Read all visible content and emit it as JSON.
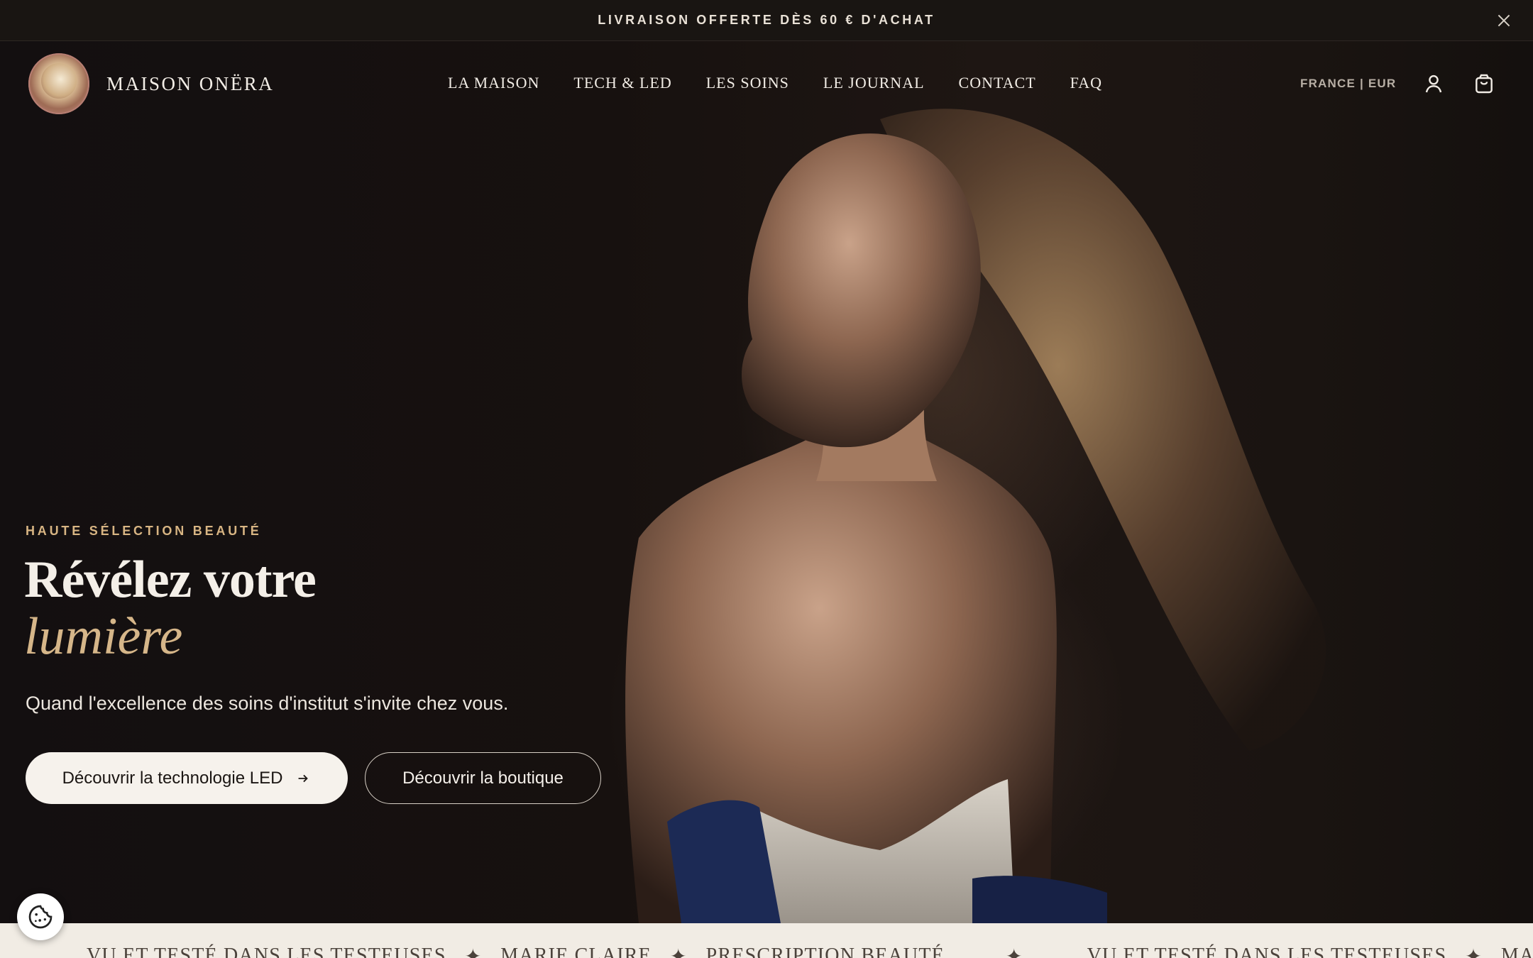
{
  "announcement": {
    "text": "LIVRAISON OFFERTE DÈS 60 € D'ACHAT",
    "close_icon": "close-icon"
  },
  "header": {
    "brand": "MAISON ONËRA",
    "nav": [
      {
        "label": "LA MAISON"
      },
      {
        "label": "TECH & LED"
      },
      {
        "label": "LES SOINS"
      },
      {
        "label": "LE JOURNAL"
      },
      {
        "label": "CONTACT"
      },
      {
        "label": "FAQ"
      }
    ],
    "locale": "FRANCE | EUR",
    "account_icon": "user-icon",
    "cart_icon": "shopping-bag-icon"
  },
  "hero": {
    "kicker": "HAUTE SÉLECTION BEAUTÉ",
    "title_line1": "Révélez votre",
    "title_line2": "lumière",
    "subtitle": "Quand l'excellence des soins d'institut s'invite chez vous.",
    "primary_cta": "Découvrir la technologie LED",
    "primary_cta_icon": "arrow-right-icon",
    "secondary_cta": "Découvrir la boutique"
  },
  "marquee": {
    "items": [
      "VU ET TESTÉ DANS LES TESTEUSES",
      "✦",
      "MARIE CLAIRE",
      "✦",
      "PRESCRIPTION BEAUTÉ",
      "✦",
      "VU ET TESTÉ DANS LES TESTEUSES",
      "✦",
      "MARIE CLAIRE"
    ]
  },
  "cookie": {
    "icon": "cookie-icon"
  },
  "colors": {
    "background": "#16110f",
    "accent_gold": "#d6b689",
    "text_light": "#f4efe8",
    "marquee_bg": "#f1ece4"
  }
}
